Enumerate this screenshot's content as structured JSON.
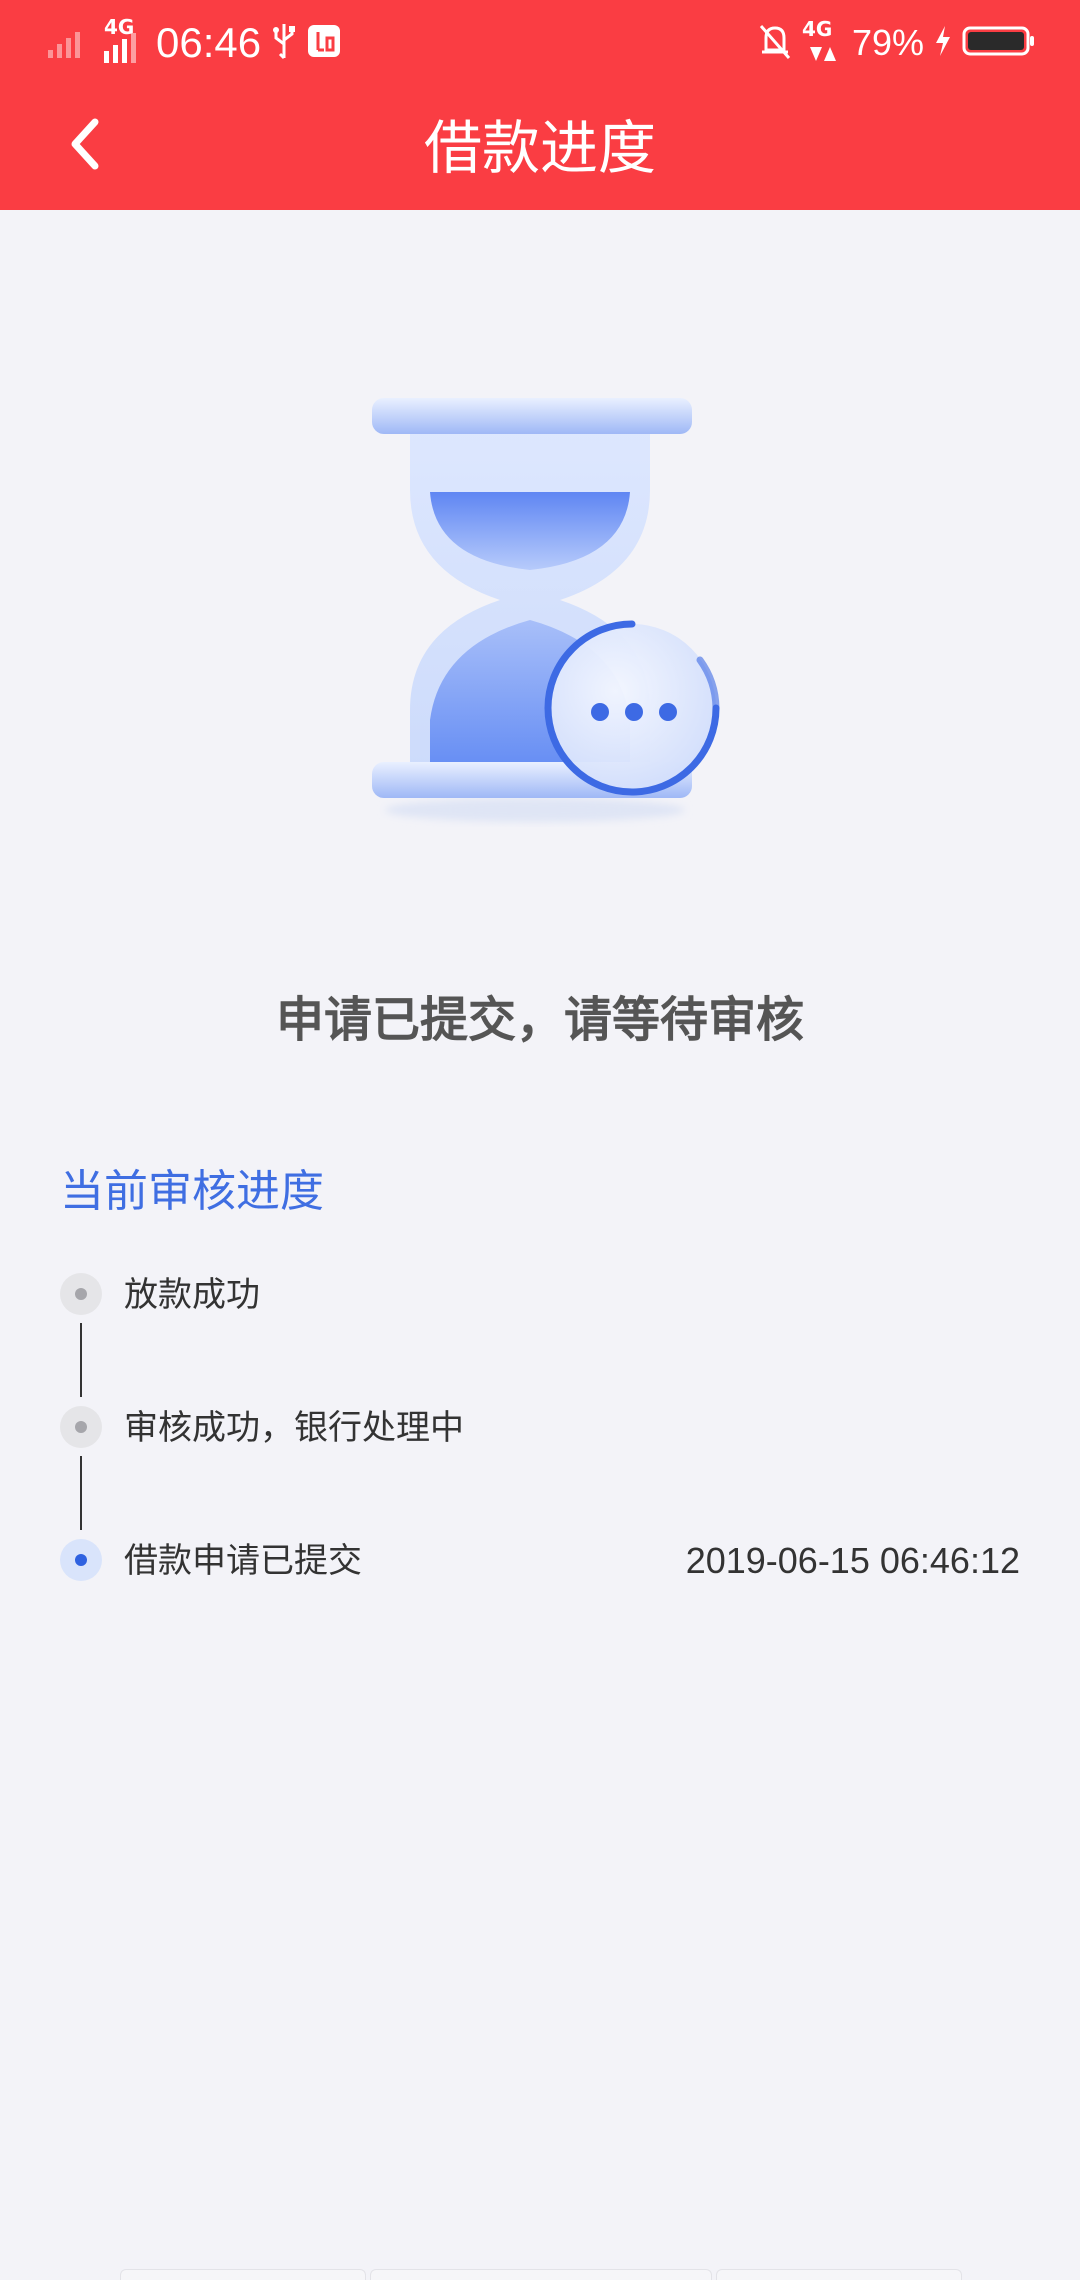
{
  "status_bar": {
    "network": "4G",
    "time": "06:46",
    "network2": "4G",
    "battery_percent": "79%",
    "battery_level": 0.79
  },
  "nav": {
    "title": "借款进度",
    "back_icon": "chevron-left-icon"
  },
  "hero": {
    "icon": "hourglass-pending-icon"
  },
  "status_message": "申请已提交，请等待审核",
  "progress": {
    "section_title": "当前审核进度",
    "steps": [
      {
        "label": "放款成功",
        "time": "",
        "active": false
      },
      {
        "label": "审核成功，银行处理中",
        "time": "",
        "active": false
      },
      {
        "label": "借款申请已提交",
        "time": "2019-06-15 06:46:12",
        "active": true
      }
    ]
  },
  "colors": {
    "header_bg": "#fa3d43",
    "page_bg": "#f3f3f8",
    "accent_blue": "#3f6ee2",
    "status_text": "#555555"
  }
}
